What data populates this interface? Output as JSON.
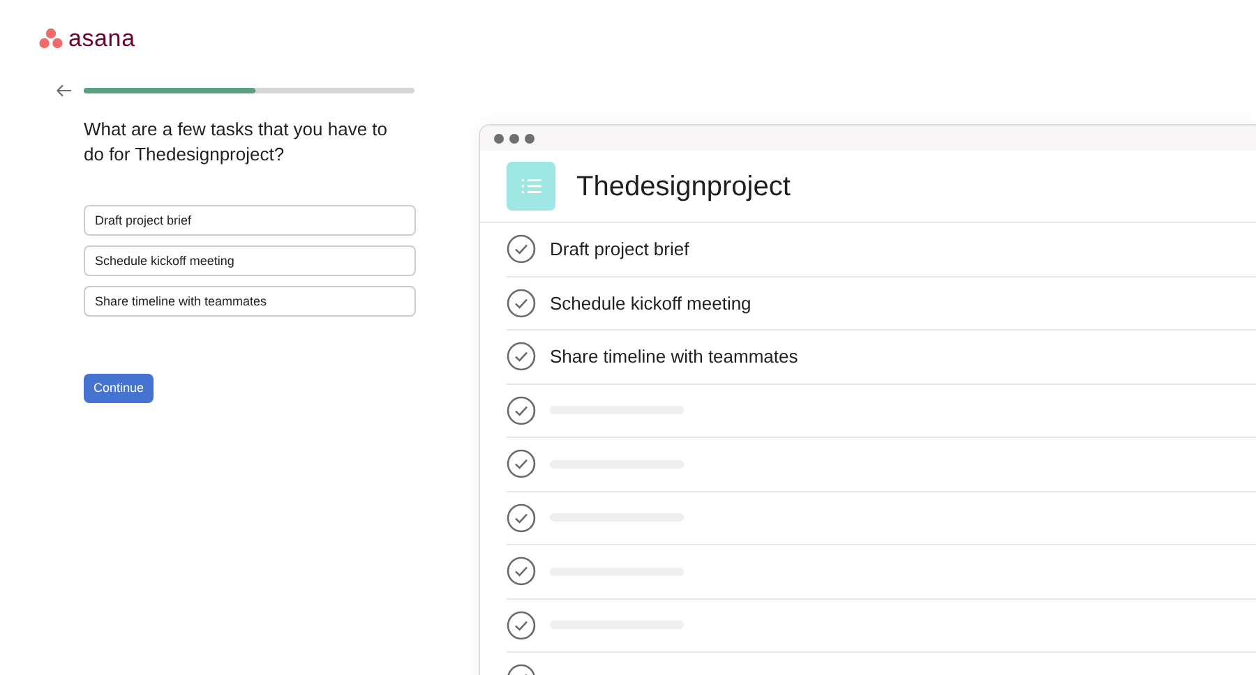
{
  "logo": {
    "text": "asana"
  },
  "progress": {
    "level": 0.52
  },
  "question": "What are a few tasks that you have to do for Thedesignproject?",
  "fields": [
    {
      "value": "Draft project brief"
    },
    {
      "value": "Schedule kickoff meeting"
    },
    {
      "value": "Share timeline with teammates"
    }
  ],
  "continue_button": "Continue",
  "preview": {
    "project_title": "Thedesignproject",
    "tasks": [
      {
        "kind": "task",
        "name": "Draft project brief"
      },
      {
        "kind": "task",
        "name": "Schedule kickoff meeting"
      },
      {
        "kind": "task",
        "name": "Share timeline with teammates"
      },
      {
        "kind": "placeholder"
      },
      {
        "kind": "placeholder"
      },
      {
        "kind": "placeholder"
      },
      {
        "kind": "placeholder"
      },
      {
        "kind": "placeholder"
      },
      {
        "kind": "placeholder"
      }
    ]
  }
}
